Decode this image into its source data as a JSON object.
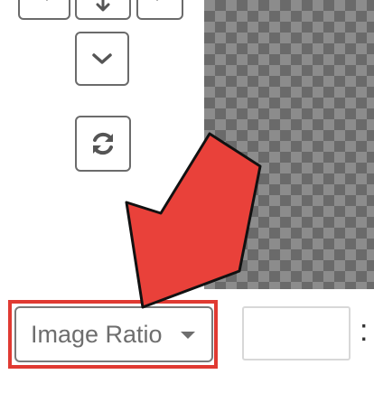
{
  "crop_controls": {
    "ratio_select": {
      "label": "Image Ratio",
      "caret_icon": "caret-down-icon"
    },
    "ratio_width_input": {
      "value": "",
      "placeholder": ""
    },
    "ratio_separator": ":",
    "icons": {
      "left": "chevron-left-icon",
      "middle": "arrow-down-icon",
      "right": "chevron-right-icon",
      "down": "chevron-down-icon",
      "reset": "refresh-icon"
    }
  },
  "annotation": {
    "arrow_color": "#e9413a",
    "highlight_color": "#e03a32"
  }
}
